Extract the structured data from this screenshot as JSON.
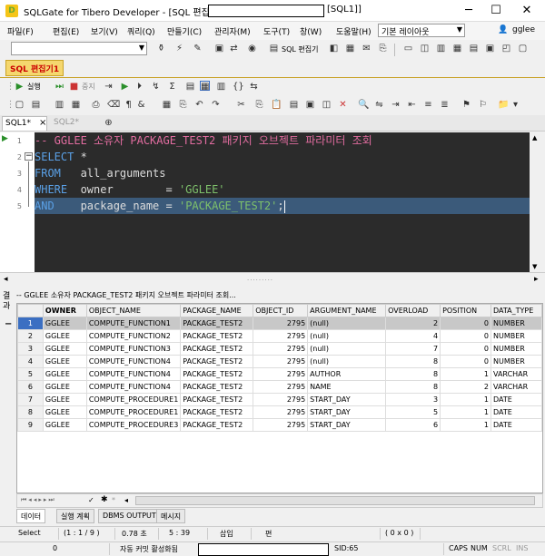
{
  "window": {
    "title": "SQLGate for Tibero Developer - [SQL 편집기 -",
    "title_suffix": "[SQL1]]",
    "min": "─",
    "max": "☐",
    "close": "✕"
  },
  "menu": [
    "파일(F)",
    "편집(E)",
    "보기(V)",
    "쿼리(Q)",
    "만들기(C)",
    "관리자(M)",
    "도구(T)",
    "창(W)",
    "도움말(H)"
  ],
  "layout_combo": "기본 레이아웃",
  "user": "gglee",
  "toolbar": {
    "sql_editor": "SQL 편집기"
  },
  "sql_tab": "SQL 편집기1",
  "run": {
    "execute": "실행",
    "stop": "중지"
  },
  "editor_tabs": [
    {
      "label": "SQL1*",
      "close": "×"
    },
    {
      "label": "SQL2*"
    }
  ],
  "code": {
    "lines": [
      {
        "n": "1",
        "text": "-- GGLEE 소유자 PACKAGE_TEST2 패키지 오브젝트 파라미터 조회"
      },
      {
        "n": "2",
        "kw": "SELECT",
        "rest": " *"
      },
      {
        "n": "3",
        "kw": "FROM",
        "rest": "   all_arguments"
      },
      {
        "n": "4",
        "kw": "WHERE",
        "rest": "  owner        = ",
        "str": "'GGLEE'"
      },
      {
        "n": "5",
        "kw": "AND",
        "rest": "    package_name = ",
        "str": "'PACKAGE_TEST2'",
        "tail": ";"
      }
    ]
  },
  "result": {
    "side_label": "결과",
    "header": "-- GGLEE 소유자 PACKAGE_TEST2 패키지 오브젝트 파라미터 조회...",
    "columns": [
      "OWNER",
      "OBJECT_NAME",
      "PACKAGE_NAME",
      "OBJECT_ID",
      "ARGUMENT_NAME",
      "OVERLOAD",
      "POSITION",
      "DATA_TYPE"
    ],
    "rows": [
      [
        "1",
        "GGLEE",
        "COMPUTE_FUNCTION1",
        "PACKAGE_TEST2",
        "2795",
        "(null)",
        "2",
        "0",
        "NUMBER"
      ],
      [
        "2",
        "GGLEE",
        "COMPUTE_FUNCTION2",
        "PACKAGE_TEST2",
        "2795",
        "(null)",
        "4",
        "0",
        "NUMBER"
      ],
      [
        "3",
        "GGLEE",
        "COMPUTE_FUNCTION3",
        "PACKAGE_TEST2",
        "2795",
        "(null)",
        "7",
        "0",
        "NUMBER"
      ],
      [
        "4",
        "GGLEE",
        "COMPUTE_FUNCTION4",
        "PACKAGE_TEST2",
        "2795",
        "(null)",
        "8",
        "0",
        "NUMBER"
      ],
      [
        "5",
        "GGLEE",
        "COMPUTE_FUNCTION4",
        "PACKAGE_TEST2",
        "2795",
        "AUTHOR",
        "8",
        "1",
        "VARCHAR"
      ],
      [
        "6",
        "GGLEE",
        "COMPUTE_FUNCTION4",
        "PACKAGE_TEST2",
        "2795",
        "NAME",
        "8",
        "2",
        "VARCHAR"
      ],
      [
        "7",
        "GGLEE",
        "COMPUTE_PROCEDURE1",
        "PACKAGE_TEST2",
        "2795",
        "START_DAY",
        "3",
        "1",
        "DATE"
      ],
      [
        "8",
        "GGLEE",
        "COMPUTE_PROCEDURE1",
        "PACKAGE_TEST2",
        "2795",
        "START_DAY",
        "5",
        "1",
        "DATE"
      ],
      [
        "9",
        "GGLEE",
        "COMPUTE_PROCEDURE3",
        "PACKAGE_TEST2",
        "2795",
        "START_DAY",
        "6",
        "1",
        "DATE"
      ]
    ]
  },
  "bottom_tabs": [
    "데이터",
    "실행 계획",
    "DBMS OUTPUT",
    "메시지"
  ],
  "status1": {
    "mode": "Select",
    "pos": "(1 : 1 / 9 )",
    "time": "0.78 초",
    "clock": "5 : 39",
    "insert": "삽입",
    "edit": "편",
    "coord": "( 0 x 0 )"
  },
  "status2": {
    "count": "0",
    "autocommit": "자동 커밋 활성화됨",
    "sid": "SID:65",
    "caps": "CAPS",
    "num": "NUM",
    "scrl": "SCRL",
    "ins": "INS"
  },
  "colors": {
    "editor_bg": "#2b2b2b",
    "comment": "#e06c9f",
    "keyword": "#5aa0e6",
    "string": "#7ec16b",
    "current_line": "#3b5a7a"
  }
}
